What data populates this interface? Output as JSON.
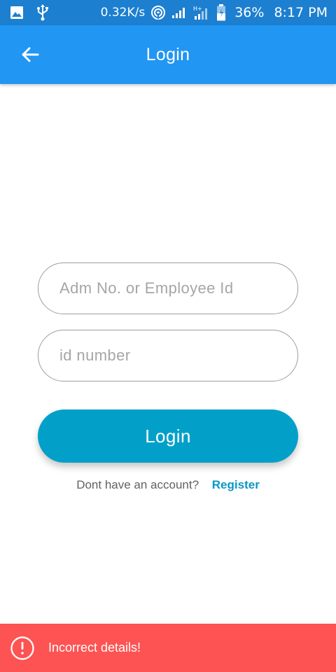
{
  "status_bar": {
    "network_speed": "0.32K/s",
    "battery_percent": "36%",
    "time": "8:17 PM",
    "network_type": "H+",
    "icons": [
      "gallery-icon",
      "usb-icon",
      "hotspot-icon",
      "signal-icon",
      "signal-icon",
      "battery-icon"
    ]
  },
  "app_bar": {
    "title": "Login",
    "back_icon": "arrow-left-icon"
  },
  "form": {
    "adm_placeholder": "Adm No. or Employee Id",
    "adm_value": "",
    "id_placeholder": "id number",
    "id_value": "",
    "login_label": "Login"
  },
  "register": {
    "prompt": "Dont have an account?",
    "link_label": "Register"
  },
  "snackbar": {
    "message": "Incorrect details!",
    "icon": "info-icon"
  },
  "colors": {
    "status_bar": "#1d7fd0",
    "app_bar": "#2196f3",
    "login_button": "#02a0c9",
    "register_link": "#0a97c3",
    "snackbar": "#fd5353"
  }
}
